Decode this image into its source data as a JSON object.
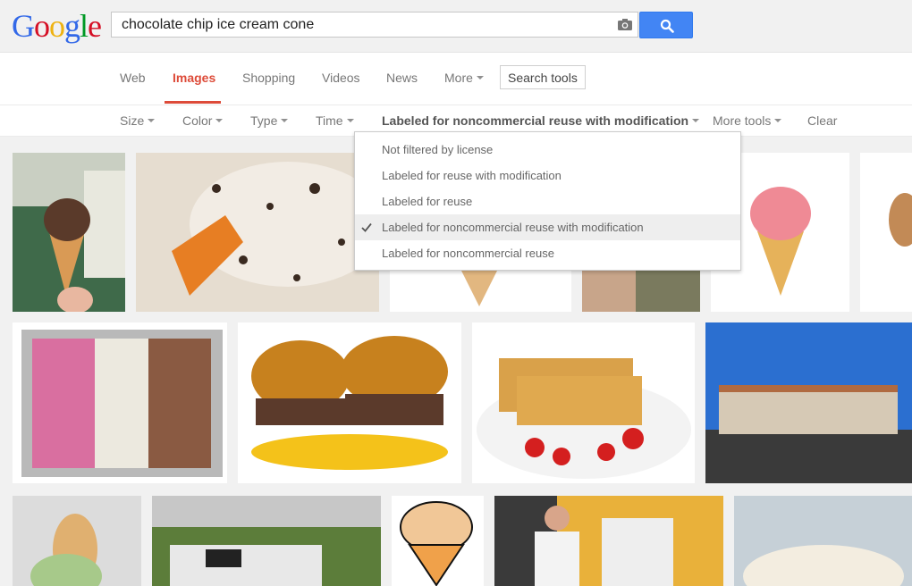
{
  "logo": {
    "letters": [
      "G",
      "o",
      "o",
      "g",
      "l",
      "e"
    ],
    "colors": [
      "#3369e8",
      "#d50f25",
      "#eeb211",
      "#3369e8",
      "#009925",
      "#d50f25"
    ]
  },
  "search": {
    "value": "chocolate chip ice cream cone",
    "button_icon": "search-icon",
    "camera_icon": "camera-icon"
  },
  "tabs": [
    {
      "label": "Web"
    },
    {
      "label": "Images",
      "active": true
    },
    {
      "label": "Shopping"
    },
    {
      "label": "Videos"
    },
    {
      "label": "News"
    },
    {
      "label": "More"
    }
  ],
  "search_tools_label": "Search tools",
  "tools": {
    "size": "Size",
    "color": "Color",
    "type": "Type",
    "time": "Time",
    "license": "Labeled for noncommercial reuse with modification",
    "more_tools": "More tools",
    "clear": "Clear"
  },
  "license_options": [
    {
      "label": "Not filtered by license"
    },
    {
      "label": "Labeled for reuse with modification"
    },
    {
      "label": "Labeled for reuse"
    },
    {
      "label": "Labeled for noncommercial reuse with modification",
      "checked": true
    },
    {
      "label": "Labeled for noncommercial reuse"
    }
  ],
  "accent_color": "#dd4b39",
  "button_color": "#4285f4"
}
